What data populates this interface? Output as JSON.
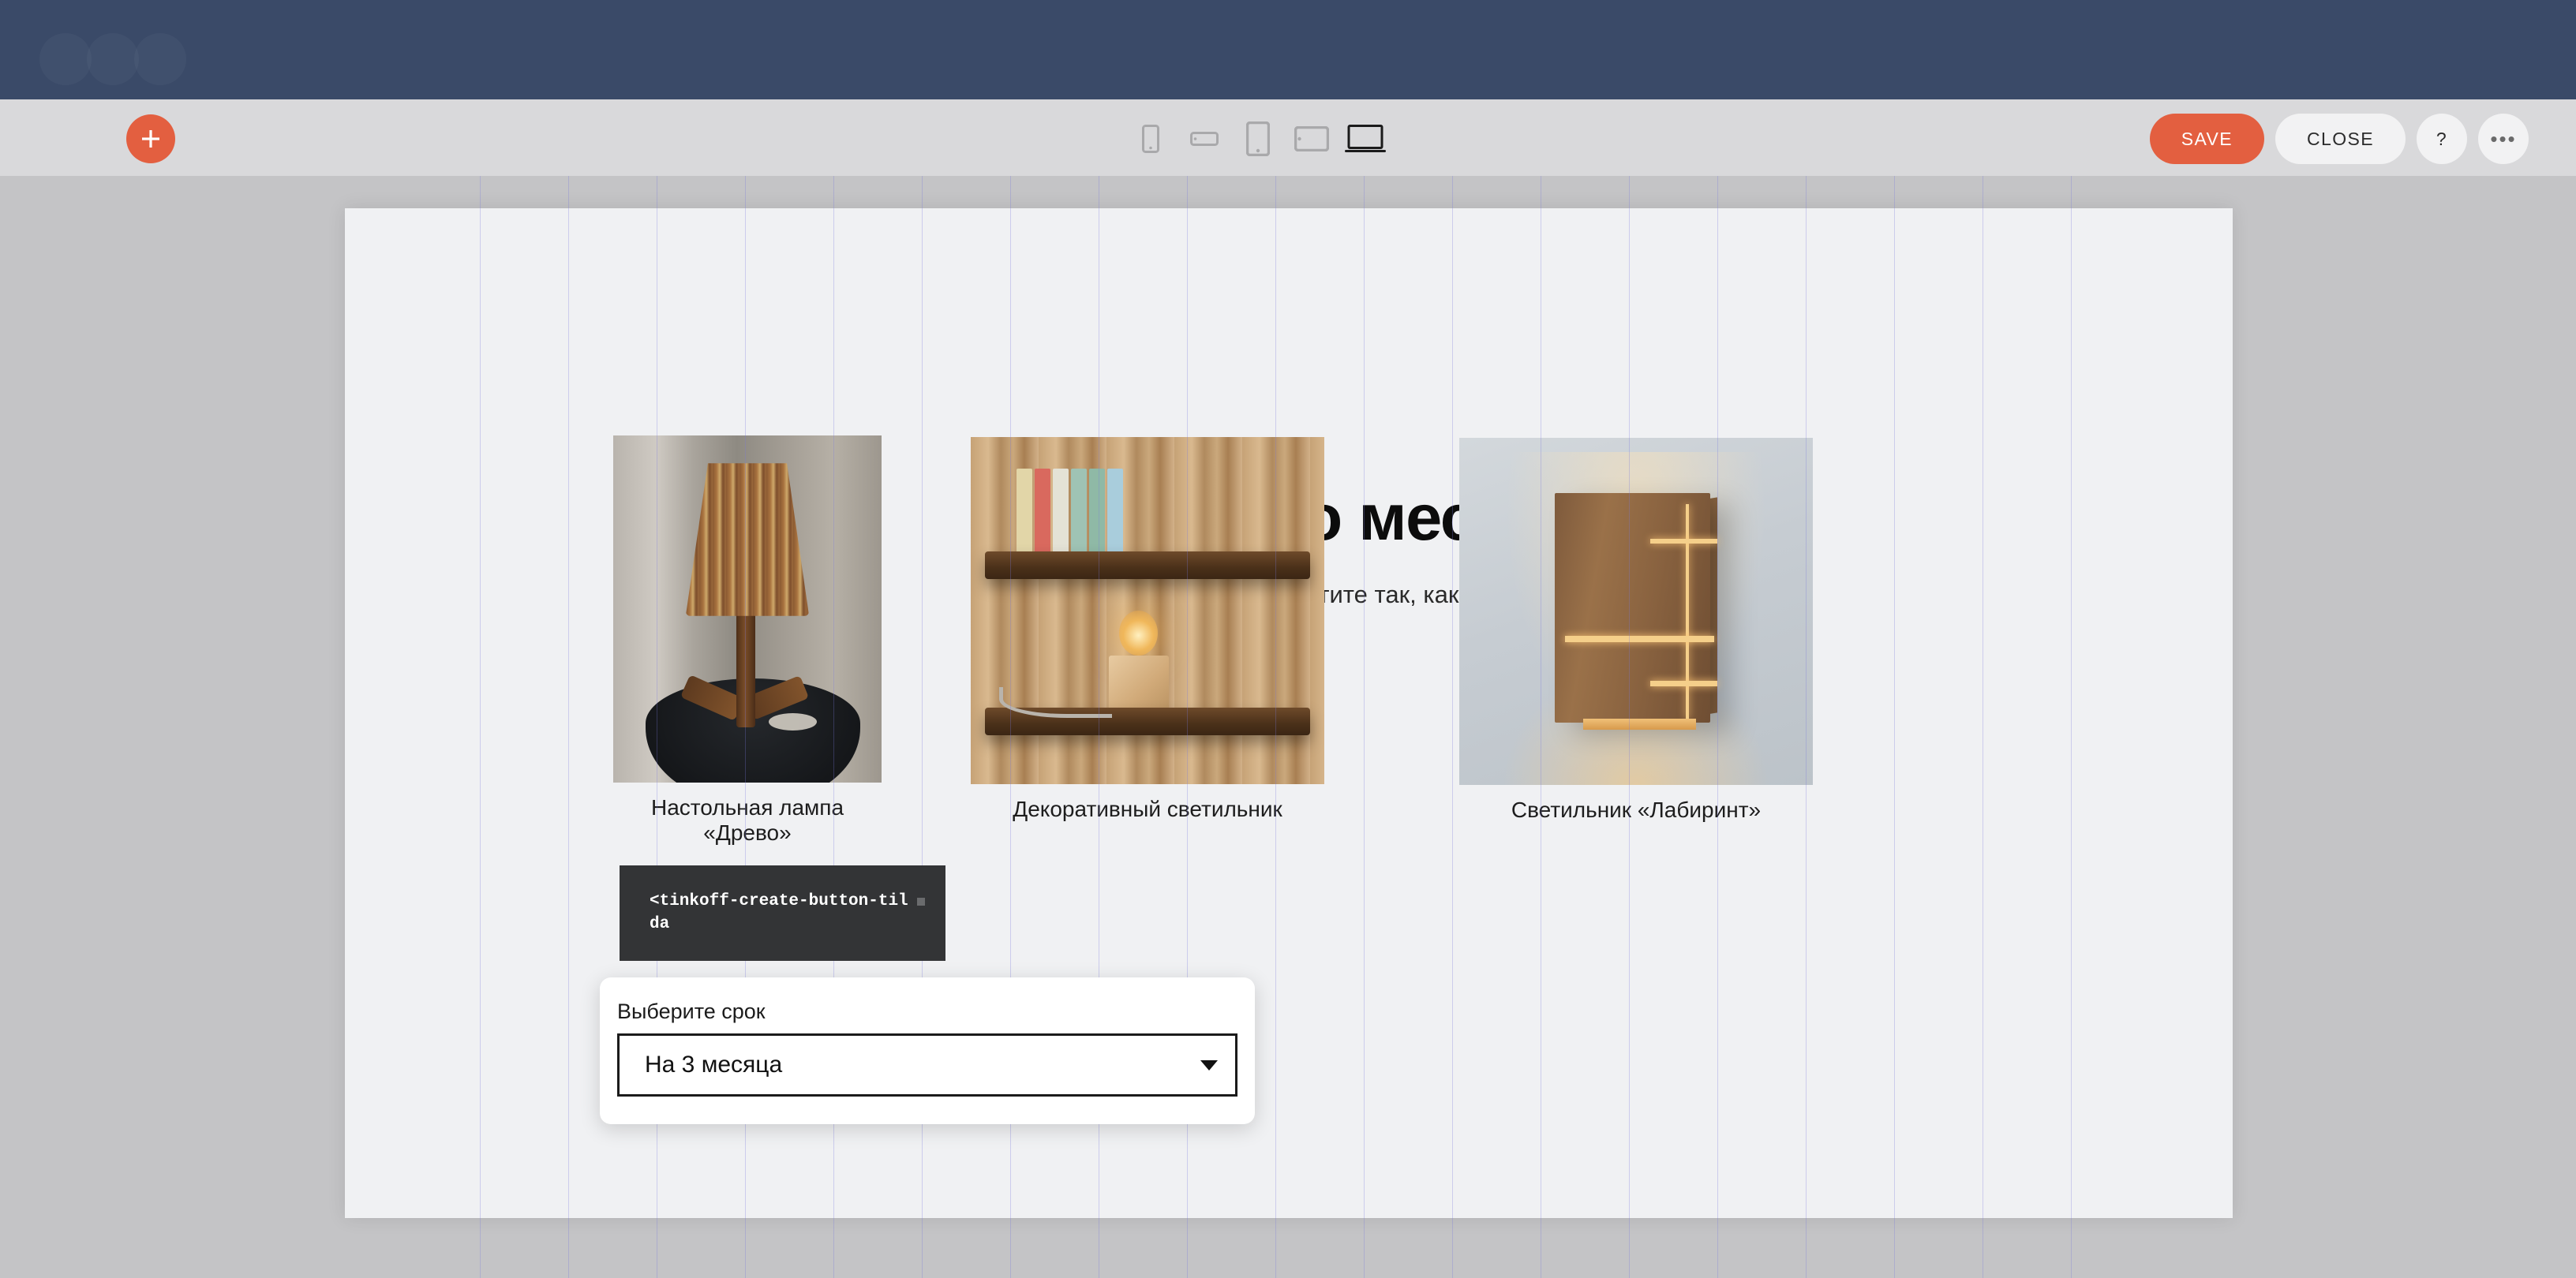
{
  "topbar": {
    "bg_color": "#3a4a68"
  },
  "toolbar": {
    "add_label": "+",
    "add_icon": "plus-icon",
    "accent_color": "#e35f40",
    "devices": [
      {
        "name": "phone-portrait",
        "label": "Phone portrait",
        "active": false
      },
      {
        "name": "phone-landscape",
        "label": "Phone landscape",
        "active": false
      },
      {
        "name": "tablet-portrait",
        "label": "Tablet portrait",
        "active": false
      },
      {
        "name": "tablet-landscape",
        "label": "Tablet landscape",
        "active": false
      },
      {
        "name": "desktop",
        "label": "Desktop",
        "active": true
      }
    ],
    "save_label": "SAVE",
    "close_label": "CLOSE",
    "help_label": "?",
    "more_label": "•••"
  },
  "page": {
    "title": "Хиты этого месяца",
    "subtitle": "Купите в рассрочку и платите так, как удобно",
    "products": [
      {
        "caption": "Настольная лампа «Древо»",
        "image": "wooden-stick-table-lamp"
      },
      {
        "caption": "Декоративный светильник",
        "image": "rustic-shelf-edison-lamp"
      },
      {
        "caption": "Светильник «Лабиринт»",
        "image": "wooden-wall-sconce"
      }
    ]
  },
  "code_widget": {
    "code": "<tinkoff-create-button-tilda",
    "bg_color": "#333436"
  },
  "select_widget": {
    "label": "Выберите срок",
    "value": "На 3 месяца",
    "caret_icon": "chevron-down-icon"
  }
}
